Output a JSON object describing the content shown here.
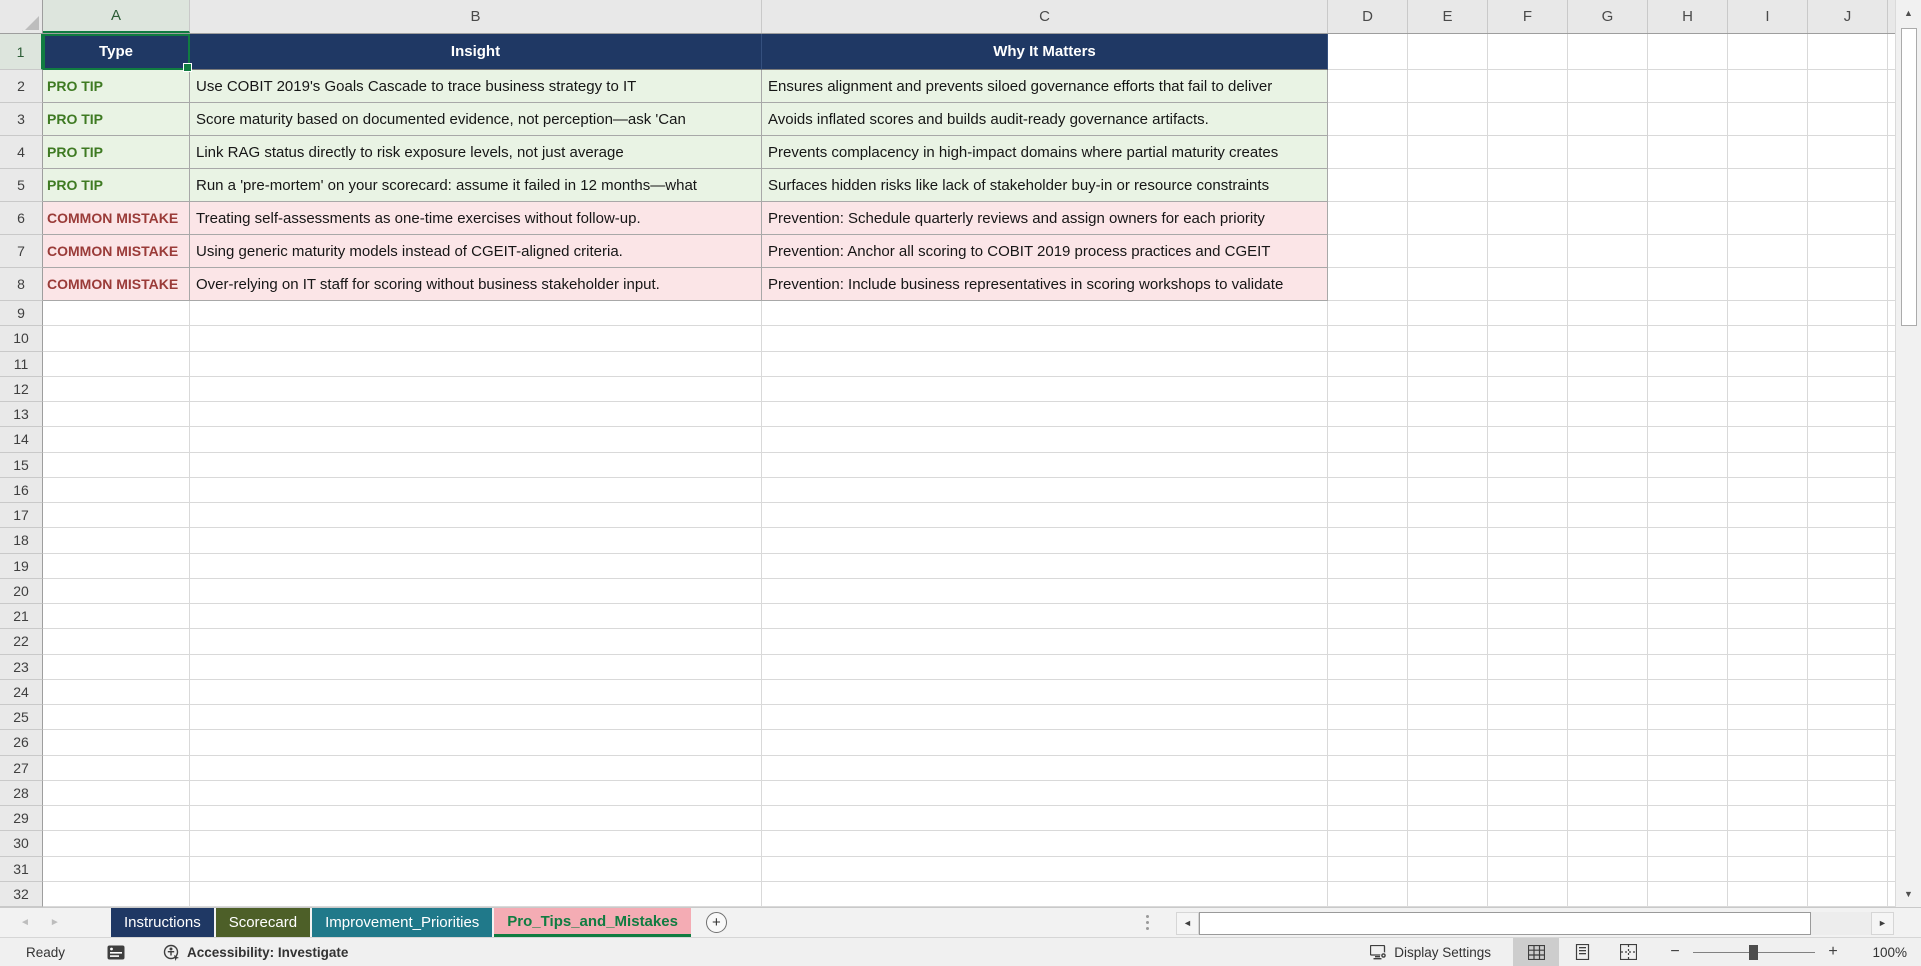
{
  "colors": {
    "header_fill": "#1F3864",
    "protip_bg": "#E9F3E4",
    "protip_text": "#3E7A22",
    "mistake_bg": "#FBE5E7",
    "mistake_text": "#9A3B38",
    "selection_green": "#107C41",
    "grid_line": "#D9D9D9"
  },
  "grid": {
    "column_letters": [
      "A",
      "B",
      "C",
      "D",
      "E",
      "F",
      "G",
      "H",
      "I",
      "J"
    ],
    "row_count": 32,
    "selected_cell": "A1",
    "selected_column": "A",
    "selected_row": 1
  },
  "sheet": {
    "headers": [
      "Type",
      "Insight",
      "Why It Matters"
    ],
    "rows": [
      {
        "kind": "protip",
        "type": "PRO TIP",
        "insight": "Use COBIT 2019's Goals Cascade to trace business strategy to IT",
        "why": "Ensures alignment and prevents siloed governance efforts that fail to deliver"
      },
      {
        "kind": "protip",
        "type": "PRO TIP",
        "insight": "Score maturity based on documented evidence, not perception—ask 'Can",
        "why": "Avoids inflated scores and builds audit-ready governance artifacts."
      },
      {
        "kind": "protip",
        "type": "PRO TIP",
        "insight": "Link RAG status directly to risk exposure levels, not just average",
        "why": "Prevents complacency in high-impact domains where partial maturity creates"
      },
      {
        "kind": "protip",
        "type": "PRO TIP",
        "insight": "Run a 'pre-mortem' on your scorecard: assume it failed in 12 months—what",
        "why": "Surfaces hidden risks like lack of stakeholder buy-in or resource constraints"
      },
      {
        "kind": "mistake",
        "type": "COMMON MISTAKE",
        "insight": "Treating self-assessments as one-time exercises without follow-up.",
        "why": "Prevention: Schedule quarterly reviews and assign owners for each priority"
      },
      {
        "kind": "mistake",
        "type": "COMMON MISTAKE",
        "insight": "Using generic maturity models instead of CGEIT-aligned criteria.",
        "why": "Prevention: Anchor all scoring to COBIT 2019 process practices and CGEIT"
      },
      {
        "kind": "mistake",
        "type": "COMMON MISTAKE",
        "insight": "Over-relying on IT staff for scoring without business stakeholder input.",
        "why": "Prevention: Include business representatives in scoring workshops to validate"
      }
    ]
  },
  "tabs": {
    "items": [
      {
        "label": "Instructions",
        "bg": "#1F3864",
        "text": "#FFFFFF",
        "active": false
      },
      {
        "label": "Scorecard",
        "bg": "#4D5F28",
        "text": "#FFFFFF",
        "active": false
      },
      {
        "label": "Improvement_Priorities",
        "bg": "#20798A",
        "text": "#FFFFFF",
        "active": false
      },
      {
        "label": "Pro_Tips_and_Mistakes",
        "bg": "#F4ACB4",
        "text": "#107C41",
        "active": true
      }
    ],
    "add_button": "+"
  },
  "status_bar": {
    "ready_label": "Ready",
    "accessibility_label": "Accessibility: Investigate",
    "display_settings_label": "Display Settings",
    "zoom_level": "100%"
  }
}
